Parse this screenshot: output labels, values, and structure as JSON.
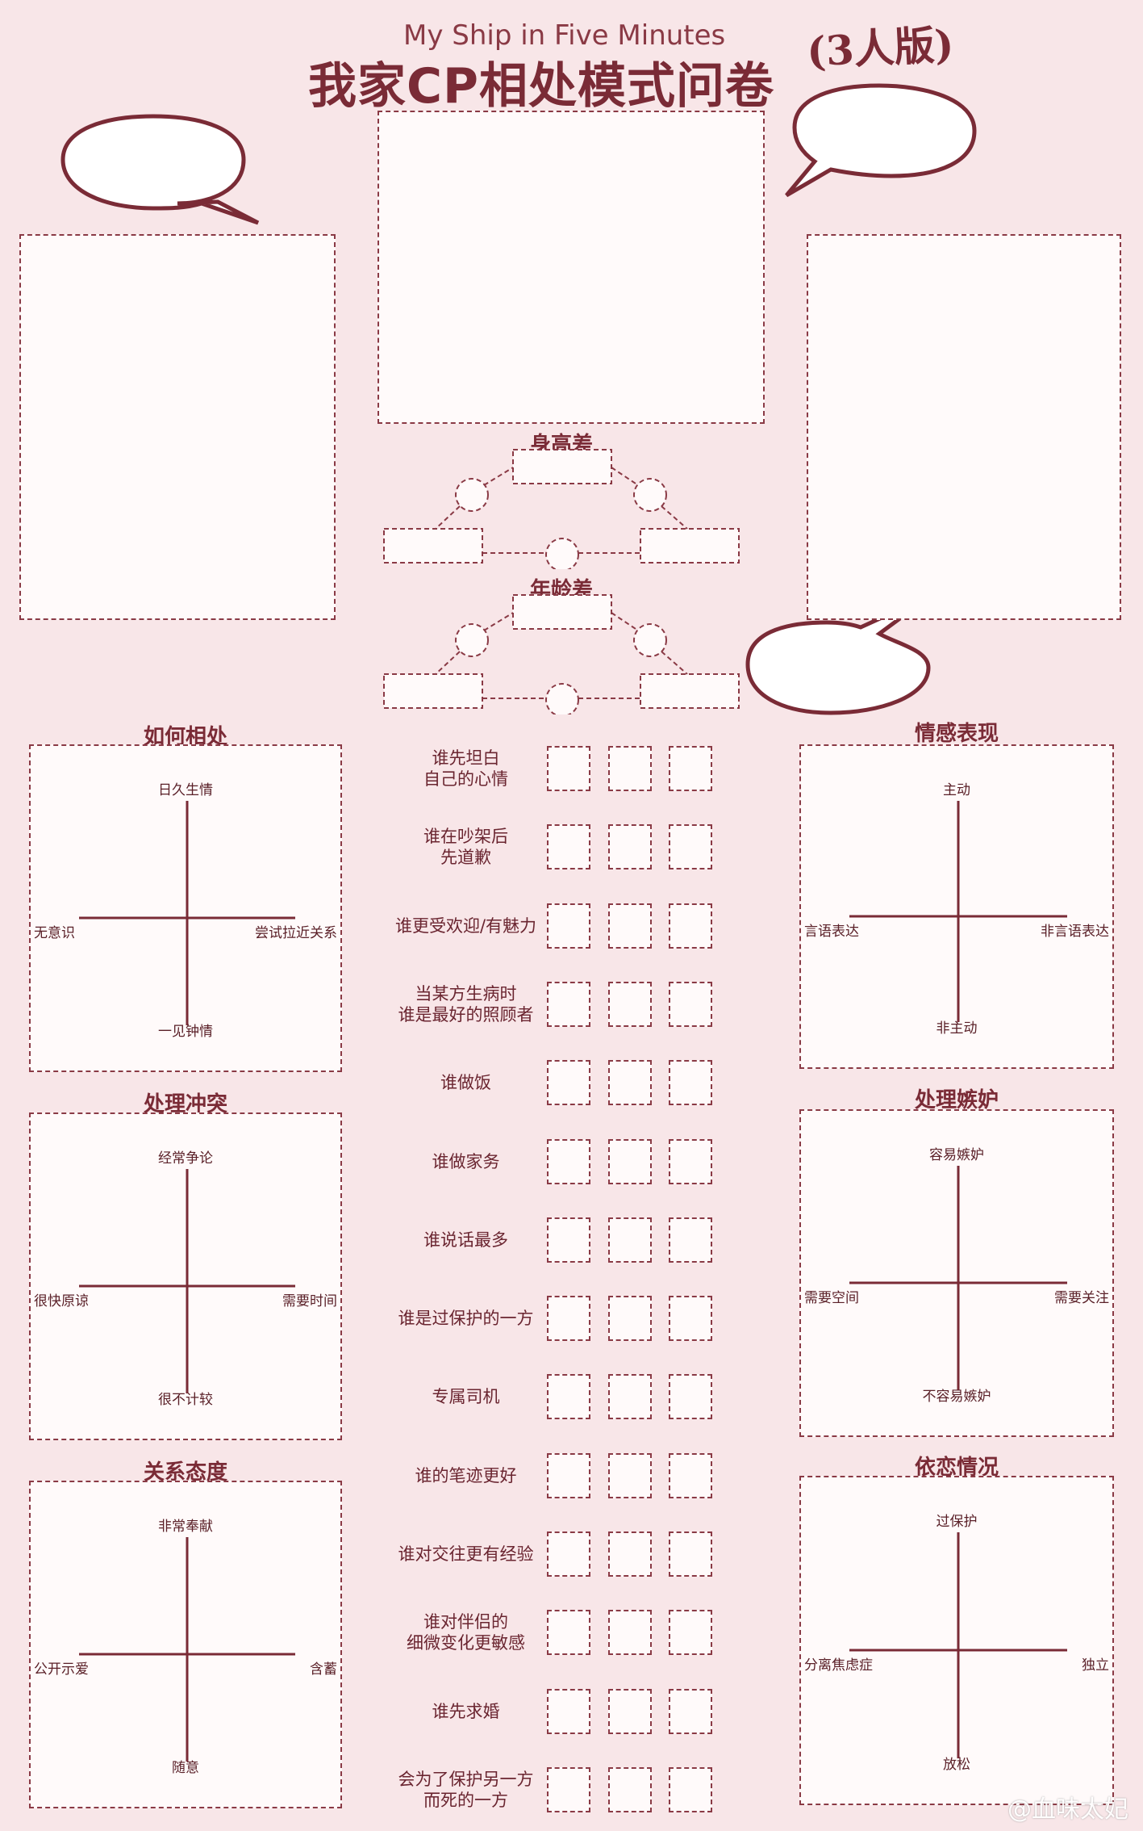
{
  "header": {
    "title_en": "My Ship in Five Minutes",
    "title_cn": "我家CP相处模式问卷",
    "edition": "(3人版)"
  },
  "diffs": {
    "height_title": "身高差",
    "age_title": "年龄差"
  },
  "quadrants": {
    "get_along": {
      "title": "如何相处",
      "top": "日久生情",
      "bottom": "一见钟情",
      "left": "无意识",
      "right": "尝试拉近关系"
    },
    "conflict": {
      "title": "处理冲突",
      "top": "经常争论",
      "bottom": "很不计较",
      "left": "很快原谅",
      "right": "需要时间"
    },
    "attitude": {
      "title": "关系态度",
      "top": "非常奉献",
      "bottom": "随意",
      "left": "公开示爱",
      "right": "含蓄"
    },
    "emotion": {
      "title": "情感表现",
      "top": "主动",
      "bottom": "非主动",
      "left": "言语表达",
      "right": "非言语表达"
    },
    "jealousy": {
      "title": "处理嫉妒",
      "top": "容易嫉妒",
      "bottom": "不容易嫉妒",
      "left": "需要空间",
      "right": "需要关注"
    },
    "dependence": {
      "title": "依恋情况",
      "top": "过保护",
      "bottom": "放松",
      "left": "分离焦虑症",
      "right": "独立"
    }
  },
  "questions": [
    "谁先坦白\n自己的心情",
    "谁在吵架后\n先道歉",
    "谁更受欢迎/有魅力",
    "当某方生病时\n谁是最好的照顾者",
    "谁做饭",
    "谁做家务",
    "谁说话最多",
    "谁是过保护的一方",
    "专属司机",
    "谁的笔迹更好",
    "谁对交往更有经验",
    "谁对伴侣的\n细微变化更敏感",
    "谁先求婚",
    "会为了保护另一方\n而死的一方"
  ],
  "watermark": "@血味太妃",
  "colors": {
    "background": "#f8e6e8",
    "accent": "#7a2b36",
    "line": "#8a3a45"
  }
}
